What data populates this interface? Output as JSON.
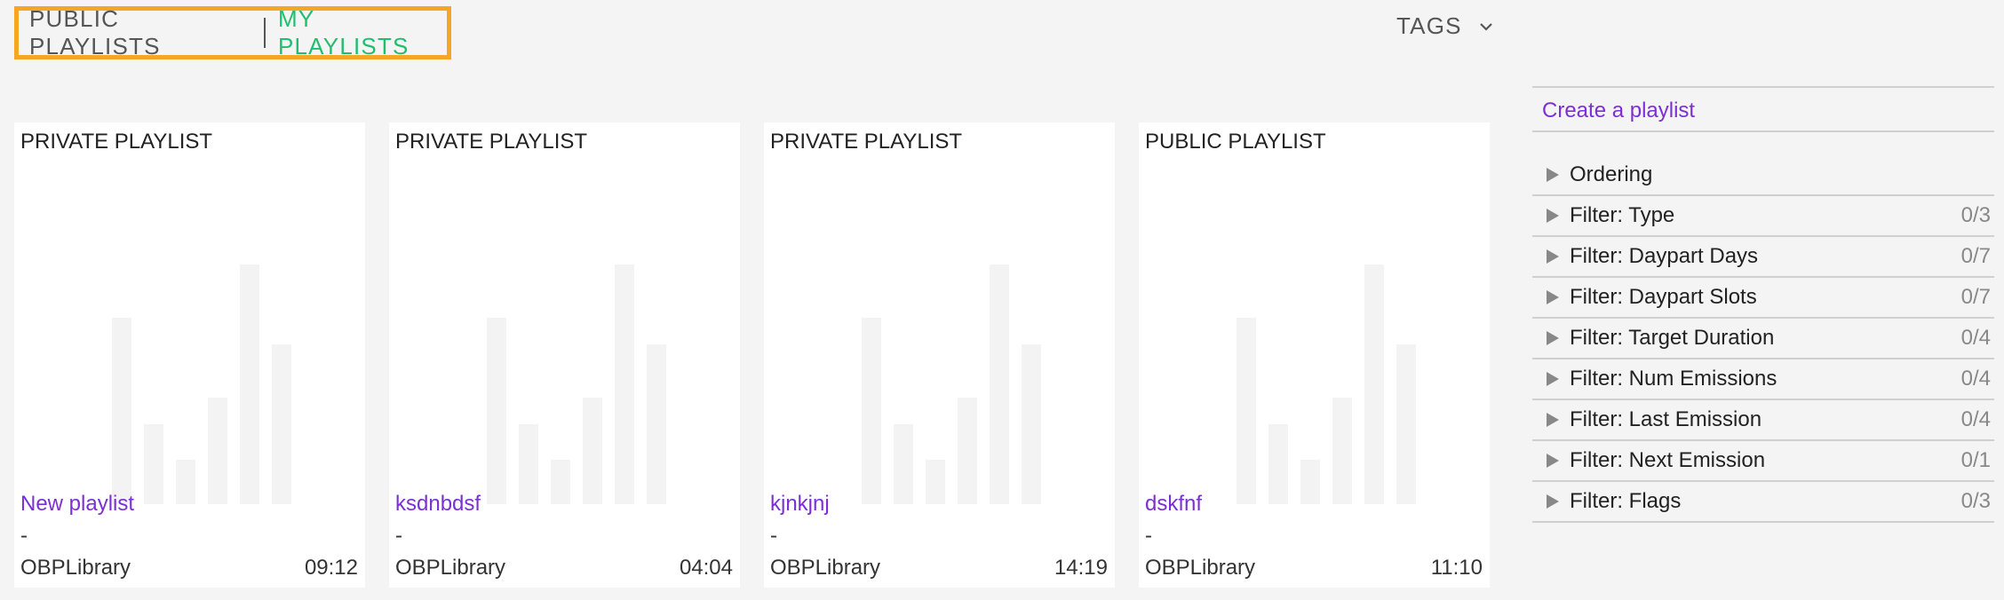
{
  "tabs": {
    "public_label": "PUBLIC PLAYLISTS",
    "my_label": "MY PLAYLISTS",
    "highlight_color": "#f5a623",
    "active_color": "#1fbf6e"
  },
  "tags": {
    "label": "TAGS",
    "icon": "chevron-down-icon"
  },
  "cards": [
    {
      "visibility": "PRIVATE PLAYLIST",
      "name": "New playlist",
      "dash": "-",
      "library": "OBPLibrary",
      "duration": "09:12"
    },
    {
      "visibility": "PRIVATE PLAYLIST",
      "name": "ksdnbdsf",
      "dash": "-",
      "library": "OBPLibrary",
      "duration": "04:04"
    },
    {
      "visibility": "PRIVATE PLAYLIST",
      "name": "kjnkjnj",
      "dash": "-",
      "library": "OBPLibrary",
      "duration": "14:19"
    },
    {
      "visibility": "PUBLIC PLAYLIST",
      "name": "dskfnf",
      "dash": "-",
      "library": "OBPLibrary",
      "duration": "11:10"
    }
  ],
  "sidebar": {
    "create_label": "Create a playlist",
    "link_color": "#7b2fd4",
    "filters": [
      {
        "label": "Ordering",
        "count": ""
      },
      {
        "label": "Filter: Type",
        "count": "0/3"
      },
      {
        "label": "Filter: Daypart Days",
        "count": "0/7"
      },
      {
        "label": "Filter: Daypart Slots",
        "count": "0/7"
      },
      {
        "label": "Filter: Target Duration",
        "count": "0/4"
      },
      {
        "label": "Filter: Num Emissions",
        "count": "0/4"
      },
      {
        "label": "Filter: Last Emission",
        "count": "0/4"
      },
      {
        "label": "Filter: Next Emission",
        "count": "0/1"
      },
      {
        "label": "Filter: Flags",
        "count": "0/3"
      }
    ]
  }
}
